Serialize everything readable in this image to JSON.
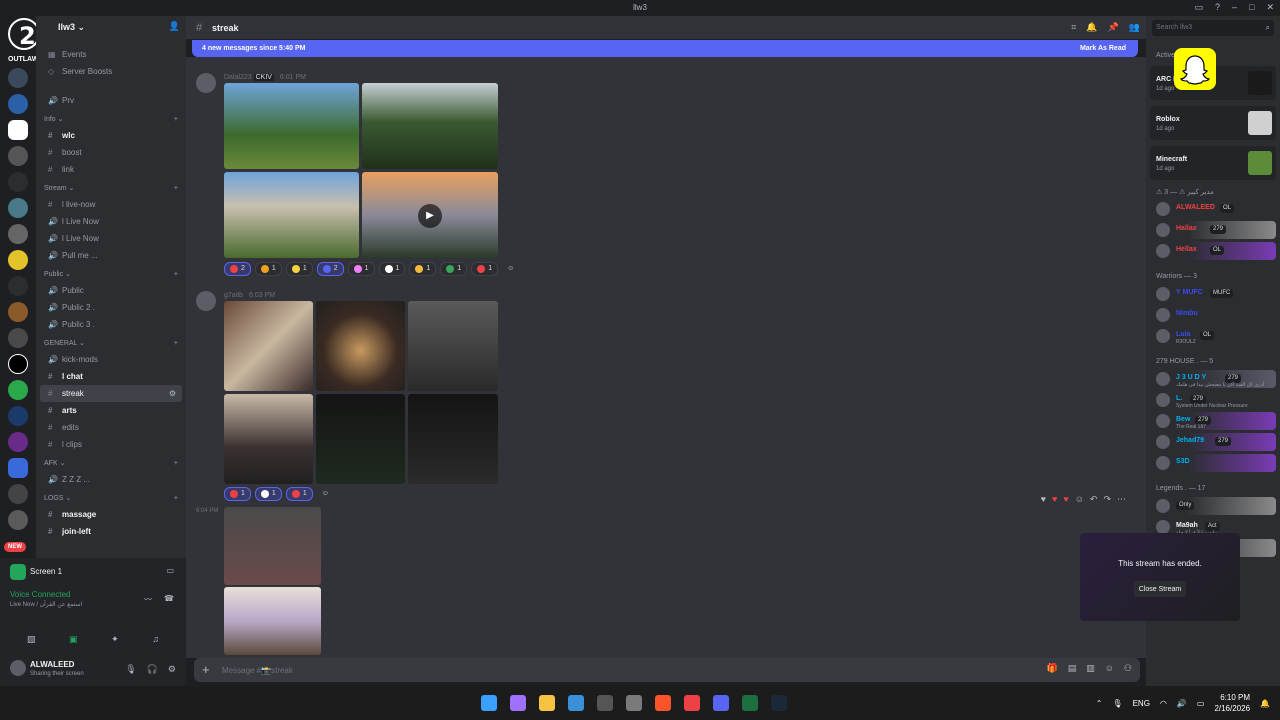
{
  "window": {
    "title": "llw3"
  },
  "logo": {
    "text": "OUTLAW RP"
  },
  "server": {
    "name": "llw3",
    "new_badge": "NEW"
  },
  "sidebar": {
    "top_items": [
      {
        "label": "Events"
      },
      {
        "label": "Server Boosts"
      },
      {
        "label": "Prv"
      }
    ],
    "categories": [
      {
        "name": "Info",
        "channels": [
          "wlc",
          "boost",
          "link"
        ]
      },
      {
        "name": "Stream",
        "channels": [
          "l live-now",
          "l Live Now",
          "l Live Now",
          "Pull me ..."
        ]
      },
      {
        "name": "Public",
        "channels": [
          "Public",
          "Public 2 .",
          "Public 3 ."
        ]
      },
      {
        "name": "GENERAL",
        "channels": [
          "kick-mods",
          "l chat",
          "streak",
          "arts",
          "edits",
          "l clips"
        ]
      },
      {
        "name": "AFK",
        "channels": [
          "Z Z Z  ..."
        ]
      },
      {
        "name": "LOGS",
        "channels": [
          "massage",
          "join-left"
        ]
      }
    ]
  },
  "voice": {
    "screen_label": "Screen 1",
    "status": "Voice Connected",
    "detail": "Live Now / استمع عن القرآن",
    "user": "ALWALEED",
    "user_status": "Sharing their screen"
  },
  "channel": {
    "name": "streak"
  },
  "banner": {
    "new_messages": "4 new messages since 5:40 PM",
    "mark_read": "Mark As Read"
  },
  "messages": [
    {
      "author": "Dalal223",
      "badge": "CKIV",
      "time": "6:01 PM",
      "reactions": [
        {
          "count": "2",
          "color": "#ed4245",
          "me": true
        },
        {
          "count": "1",
          "color": "#f0a020",
          "me": false
        },
        {
          "count": "1",
          "color": "#f5d142",
          "me": false
        },
        {
          "count": "2",
          "color": "#5865f2",
          "me": true
        },
        {
          "count": "1",
          "color": "#f47fff",
          "me": false
        },
        {
          "count": "1",
          "color": "#ffffff",
          "me": false
        },
        {
          "count": "1",
          "color": "#f5b942",
          "me": false
        },
        {
          "count": "1",
          "color": "#3ba55c",
          "me": false
        },
        {
          "count": "1",
          "color": "#ed4245",
          "me": false
        }
      ]
    },
    {
      "author": "g7aitb",
      "time": "6:03 PM",
      "reactions": [
        {
          "count": "1",
          "color": "#ed4245",
          "me": true
        },
        {
          "count": "1",
          "color": "#ffffff",
          "me": true
        },
        {
          "count": "1",
          "color": "#ed4245",
          "me": true
        }
      ]
    },
    {
      "time": "6:04 PM"
    }
  ],
  "composer": {
    "placeholder": "Message #📸streak"
  },
  "members_panel": {
    "search_placeholder": "Search llw3",
    "activity_header": "Active Now",
    "activities": [
      {
        "name": "ARC Raiders",
        "time": "1d ago",
        "thumb": "#1a1a1a"
      },
      {
        "name": "Roblox",
        "time": "1d ago",
        "thumb": "#d0d0d0"
      },
      {
        "name": "Minecraft",
        "time": "1d ago",
        "thumb": "#5c8c3a"
      }
    ],
    "groups": [
      {
        "title": "⚠ مدير كبير ⚠ — 3",
        "members": [
          {
            "name": "ALWALEED",
            "tag": "OL",
            "color": "#ed4245",
            "bg": ""
          },
          {
            "name": "Hallax",
            "tag": "279",
            "color": "#ed4245",
            "bg": "#8a8a8a"
          },
          {
            "name": "Hellax",
            "tag": "OL",
            "color": "#ed4245",
            "bg": "#7a3bb5"
          }
        ]
      },
      {
        "title": "Warriors — 3",
        "members": [
          {
            "name": "Y MUFC",
            "tag": "MUFC",
            "color": "#3b4cf2",
            "bg": ""
          },
          {
            "name": "Nimbu",
            "tag": "",
            "color": "#3b4cf2",
            "bg": ""
          },
          {
            "name": "Luia",
            "tag": "OL",
            "color": "#3b4cf2",
            "bg": "",
            "sub": "R3OULZ"
          }
        ]
      },
      {
        "title": "279 HOUSE . — 5",
        "members": [
          {
            "name": "J 3 U D Y",
            "tag": "279",
            "color": "#00b0f4",
            "bg": "#5a5a6a",
            "sub": "أدرى كل الفيه أكن يا معيحش بيدا في هلمك"
          },
          {
            "name": "L.",
            "tag": "279",
            "color": "#00b0f4",
            "bg": "",
            "sub": "System Under Nuclear Pressure"
          },
          {
            "name": "Bew",
            "tag": "279",
            "color": "#00b0f4",
            "bg": "#7a3bb5",
            "sub": "The Real 187"
          },
          {
            "name": "Jehad79",
            "tag": "279",
            "color": "#00b0f4",
            "bg": "#7a3bb5"
          },
          {
            "name": "S3D",
            "tag": "",
            "color": "#00b0f4",
            "bg": "#7a3bb5"
          }
        ]
      },
      {
        "title": "Legends . — 17",
        "members": [
          {
            "name": "",
            "tag": "Only",
            "color": "#f2f3f5",
            "bg": "#8a8a8a"
          },
          {
            "name": "Ma9ah",
            "tag": "Act",
            "color": "#f2f3f5",
            "bg": "",
            "sub": "بيات مبا لأ فرأ لا حلة"
          },
          {
            "name": "Mazen",
            "tag": "Act",
            "color": "#f2f3f5",
            "bg": "#8a8a8a"
          },
          {
            "name": "",
            "tag": "Act",
            "color": "#f2f3f5",
            "bg": ""
          }
        ]
      }
    ]
  },
  "toast": {
    "message": "This stream has ended.",
    "button": "Close Stream"
  },
  "taskbar": {
    "lang": "ENG",
    "time": "6:10 PM",
    "date": "2/16/2026",
    "apps": [
      {
        "name": "start",
        "color": "#3aa0ff"
      },
      {
        "name": "copilot",
        "color": "#a070ff"
      },
      {
        "name": "file-explorer",
        "color": "#f5c242"
      },
      {
        "name": "store",
        "color": "#3a8fd9"
      },
      {
        "name": "calculator",
        "color": "#555555"
      },
      {
        "name": "chrome",
        "color": "#7a7a7a"
      },
      {
        "name": "brave",
        "color": "#fb542b"
      },
      {
        "name": "adobe",
        "color": "#ed4245"
      },
      {
        "name": "discord",
        "color": "#5865f2"
      },
      {
        "name": "excel",
        "color": "#1d6f42"
      },
      {
        "name": "steam",
        "color": "#1b2838"
      }
    ]
  },
  "colors": {
    "accent": "#5865f2",
    "bg_main": "#313338",
    "bg_side": "#2b2d31",
    "voice_green": "#23a55a"
  }
}
